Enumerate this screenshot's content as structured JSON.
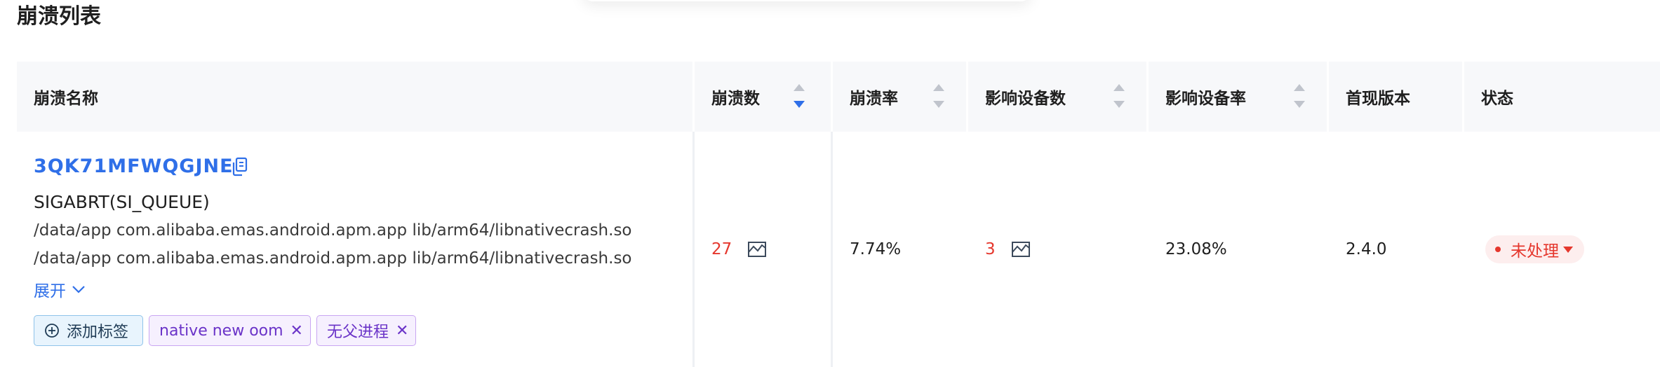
{
  "page": {
    "title": "崩溃列表"
  },
  "table": {
    "columns": [
      {
        "label": "崩溃名称"
      },
      {
        "label": "崩溃数"
      },
      {
        "label": "崩溃率"
      },
      {
        "label": "影响设备数"
      },
      {
        "label": "影响设备率"
      },
      {
        "label": "首现版本"
      },
      {
        "label": "状态"
      }
    ],
    "sort": {
      "column": "崩溃数",
      "direction": "descending"
    },
    "rows": [
      {
        "crash_id": "3QK71MFWQGJNE",
        "signal": "SIGABRT(SI_QUEUE)",
        "paths": [
          "/data/app com.alibaba.emas.android.apm.app lib/arm64/libnativecrash.so",
          "/data/app com.alibaba.emas.android.apm.app lib/arm64/libnativecrash.so"
        ],
        "expand_label": "展开",
        "add_tag_label": "添加标签",
        "tags": [
          "native new oom",
          "无父进程"
        ],
        "crash_count": "27",
        "crash_rate": "7.74%",
        "affected_devices": "3",
        "affected_device_rate": "23.08%",
        "first_version": "2.4.0",
        "status": "未处理"
      }
    ]
  },
  "colors": {
    "link": "#2f6fe8",
    "alert": "#e5372d",
    "tag_purple": "#6a33c8",
    "header_bg": "#f7f8fa"
  }
}
